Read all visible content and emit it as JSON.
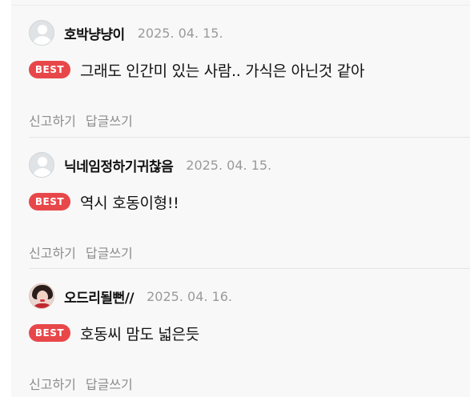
{
  "labels": {
    "best_badge": "BEST",
    "report": "신고하기",
    "reply": "답글쓰기"
  },
  "comments": [
    {
      "nickname": "호박냥냥이",
      "date": "2025. 04. 15.",
      "text": "그래도 인간미 있는 사람.. 가식은 아닌것 같아",
      "avatar": "default-avatar"
    },
    {
      "nickname": "닉네임정하기귀찮음",
      "date": "2025. 04. 15.",
      "text": "역시 호동이형!!",
      "avatar": "default-avatar"
    },
    {
      "nickname": "오드리될뻔//",
      "date": "2025. 04. 16.",
      "text": "호동씨 맘도 넓은듯",
      "avatar": "profile-photo"
    }
  ],
  "colors": {
    "badge": "#e8474a",
    "muted_text": "#8c8c8c",
    "date_text": "#9a9a9a",
    "panel_bg": "#f8f8f8"
  }
}
